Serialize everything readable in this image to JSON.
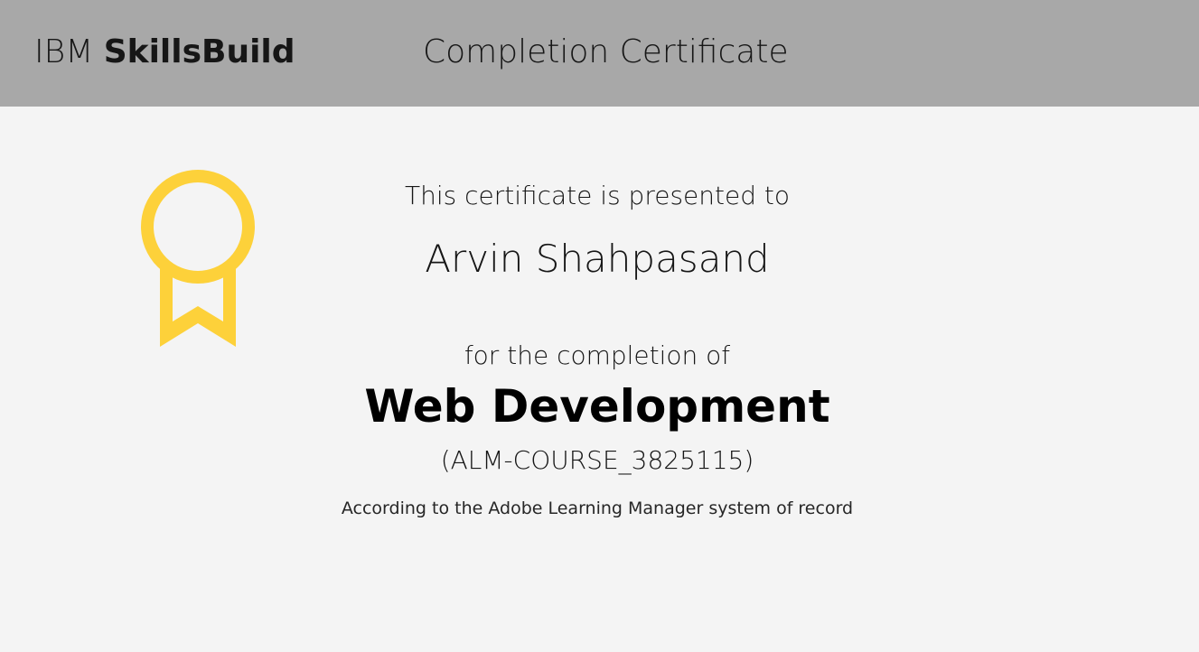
{
  "header": {
    "brand_light": "IBM",
    "brand_bold": "SkillsBuild",
    "title": "Completion Certificate"
  },
  "certificate": {
    "presented_text": "This certificate is presented to",
    "recipient_name": "Arvin Shahpasand",
    "completion_text": "for the completion of",
    "course_title": "Web Development",
    "course_code": "(ALM-COURSE_3825115)",
    "record_note": "According to the Adobe Learning Manager system of record"
  },
  "icons": {
    "badge": "award-ribbon-icon"
  },
  "colors": {
    "header_bg": "#a8a8a8",
    "page_bg": "#f4f4f4",
    "badge": "#fdd13a"
  }
}
